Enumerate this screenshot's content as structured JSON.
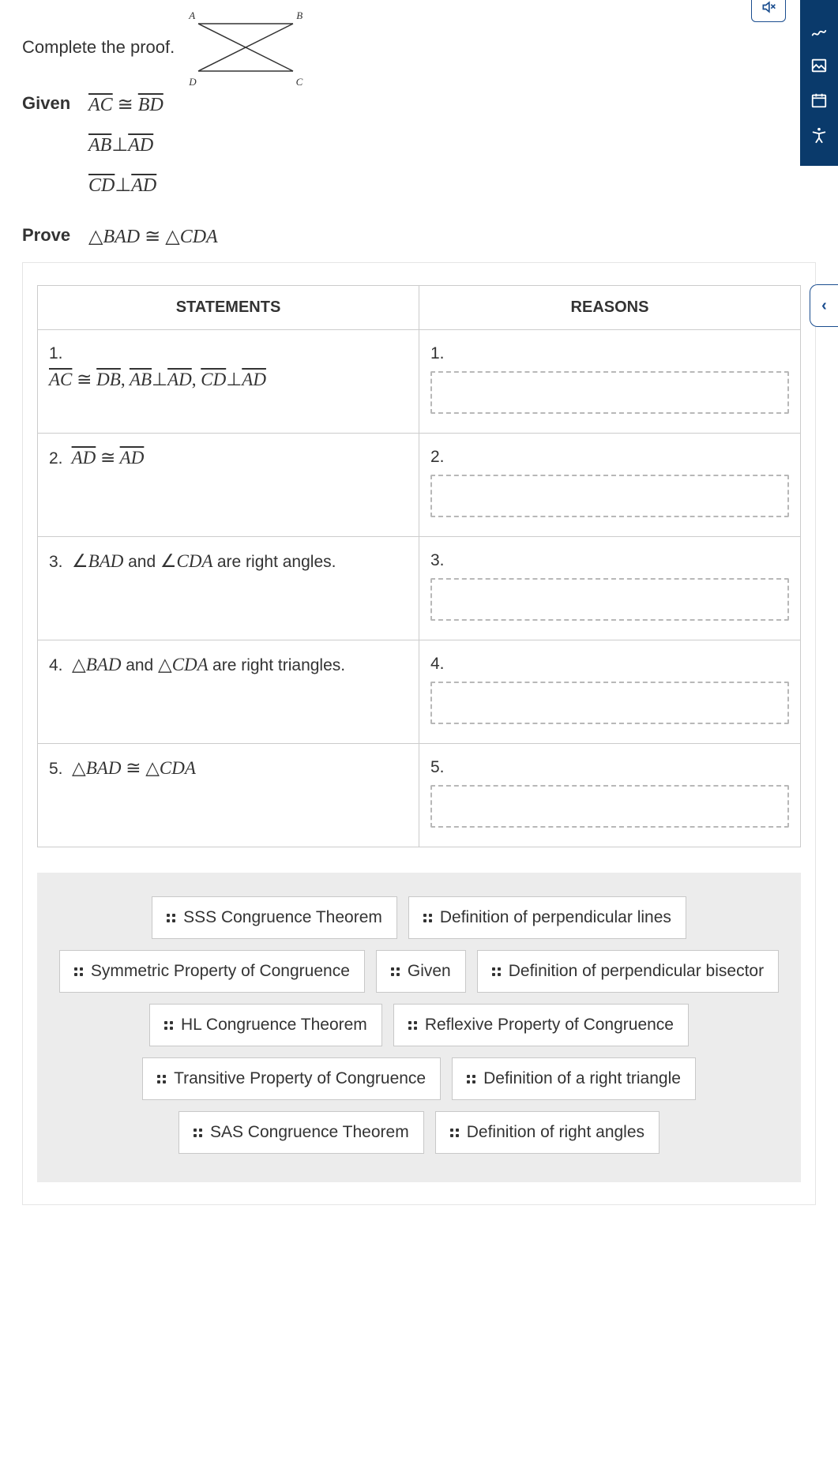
{
  "intro": {
    "text": "Complete the proof."
  },
  "diagram": {
    "labels": {
      "a": "A",
      "b": "B",
      "c": "C",
      "d": "D"
    }
  },
  "given": {
    "label": "Given",
    "lines": [
      {
        "html": "AC_cong_BD"
      },
      {
        "html": "AB_perp_AD"
      },
      {
        "html": "CD_perp_AD"
      }
    ]
  },
  "prove": {
    "label": "Prove",
    "html": "tri_BAD_cong_tri_CDA"
  },
  "table": {
    "headers": {
      "statements": "STATEMENTS",
      "reasons": "REASONS"
    },
    "rows": [
      {
        "n": "1.",
        "stmt_key": "s1",
        "rn": "1."
      },
      {
        "n": "2.",
        "stmt_key": "s2",
        "rn": "2."
      },
      {
        "n": "3.",
        "stmt_key": "s3",
        "rn": "3."
      },
      {
        "n": "4.",
        "stmt_key": "s4",
        "rn": "4."
      },
      {
        "n": "5.",
        "stmt_key": "s5",
        "rn": "5."
      }
    ],
    "statements": {
      "s1": "AC ≅ DB, AB⊥AD, CD⊥AD",
      "s2": "AD ≅ AD",
      "s3": "∠BAD and ∠CDA are right angles.",
      "s4": "△BAD and △CDA are right triangles.",
      "s5": "△BAD ≅ △CDA"
    }
  },
  "tiles": [
    "SSS Congruence Theorem",
    "Definition of perpendicular lines",
    "Symmetric Property of Congruence",
    "Given",
    "Definition of perpendicular bisector",
    "HL Congruence Theorem",
    "Reflexive Property of Congruence",
    "Transitive Property of Congruence",
    "Definition of a right triangle",
    "SAS Congruence Theorem",
    "Definition of right angles"
  ],
  "collapse": {
    "glyph": "‹"
  }
}
